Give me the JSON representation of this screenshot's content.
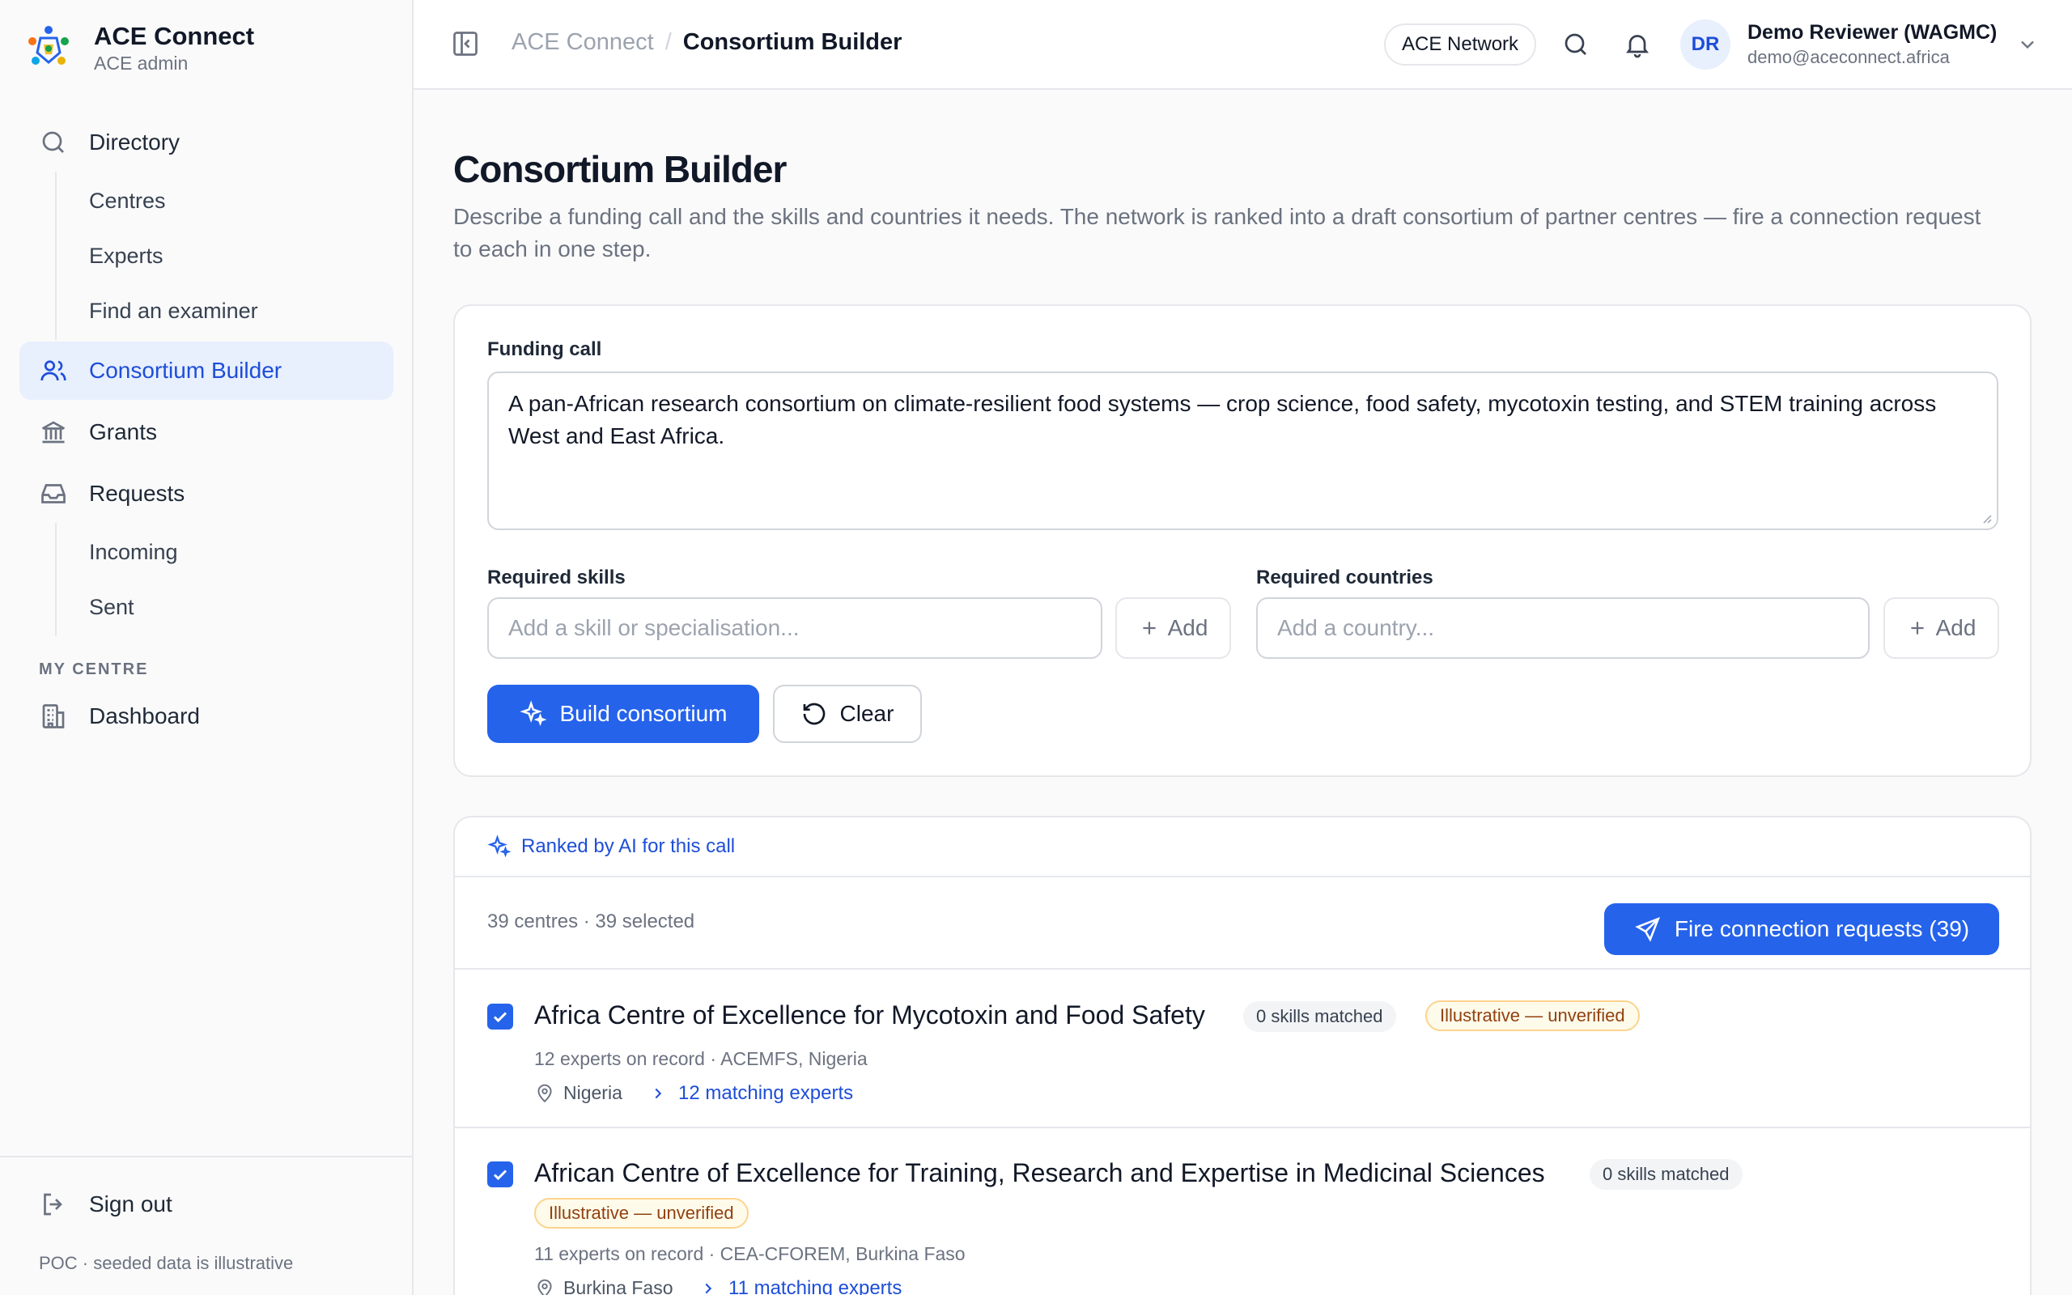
{
  "brand": {
    "name": "ACE Connect",
    "subtitle": "ACE admin"
  },
  "sidebar": {
    "directory": {
      "label": "Directory",
      "children": [
        "Centres",
        "Experts",
        "Find an examiner"
      ]
    },
    "consortium": {
      "label": "Consortium Builder"
    },
    "grants": {
      "label": "Grants"
    },
    "requests": {
      "label": "Requests",
      "children": [
        "Incoming",
        "Sent"
      ]
    },
    "section_my_centre": "MY CENTRE",
    "dashboard": {
      "label": "Dashboard"
    },
    "sign_out": "Sign out",
    "footer_note": "POC · seeded data is illustrative"
  },
  "header": {
    "breadcrumb_root": "ACE Connect",
    "breadcrumb_sep": "/",
    "breadcrumb_current": "Consortium Builder",
    "network_pill": "ACE Network",
    "user": {
      "initials": "DR",
      "name": "Demo Reviewer (WAGMC)",
      "email": "demo@aceconnect.africa"
    }
  },
  "page": {
    "title": "Consortium Builder",
    "description": "Describe a funding call and the skills and countries it needs. The network is ranked into a draft consortium of partner centres — fire a connection request to each in one step."
  },
  "form": {
    "funding_call_label": "Funding call",
    "funding_call_value": "A pan-African research consortium on climate-resilient food systems — crop science, food safety, mycotoxin testing, and STEM training across West and East Africa.",
    "skills_label": "Required skills",
    "skills_placeholder": "Add a skill or specialisation...",
    "countries_label": "Required countries",
    "countries_placeholder": "Add a country...",
    "add_label": "Add",
    "build_label": "Build consortium",
    "clear_label": "Clear"
  },
  "results": {
    "ranked_label": "Ranked by AI for this call",
    "summary": "39 centres · 39 selected",
    "fire_label": "Fire connection requests (39)",
    "centres": [
      {
        "name": "Africa Centre of Excellence for Mycotoxin and Food Safety",
        "skills_badge": "0 skills matched",
        "status_badge": "Illustrative — unverified",
        "meta": "12 experts on record · ACEMFS, Nigeria",
        "country": "Nigeria",
        "matching": "12 matching experts",
        "selected": true
      },
      {
        "name": "African Centre of Excellence for Training, Research and Expertise in Medicinal Sciences",
        "skills_badge": "0 skills matched",
        "status_badge": "Illustrative — unverified",
        "meta": "11 experts on record · CEA-CFOREM, Burkina Faso",
        "country": "Burkina Faso",
        "matching": "11 matching experts",
        "selected": true
      }
    ]
  },
  "colors": {
    "accent": "#2563eb",
    "accent_soft": "#e8effd",
    "warning": "#92400e"
  }
}
